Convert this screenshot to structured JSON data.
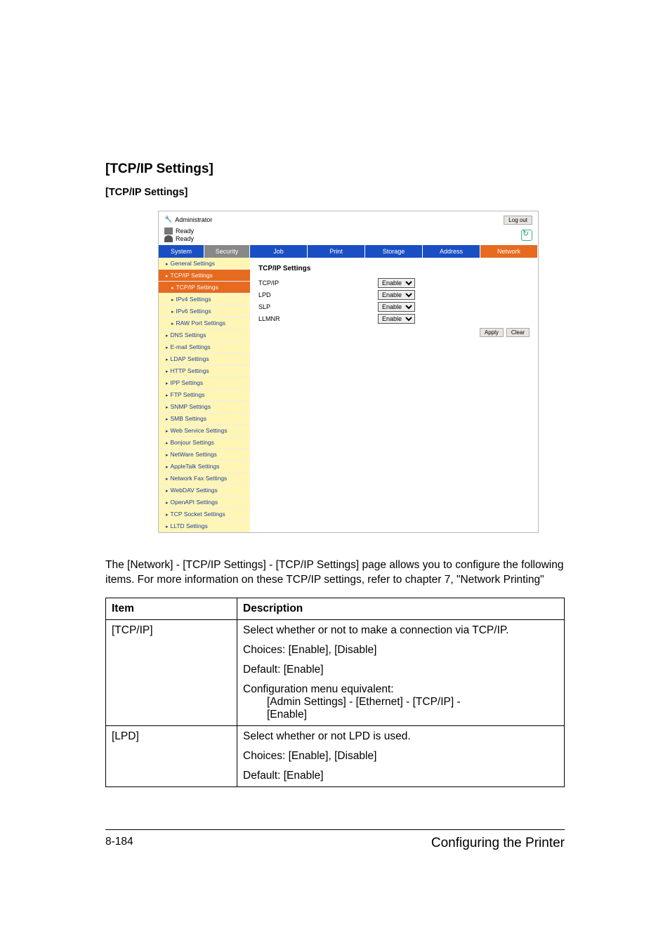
{
  "headings": {
    "section": "[TCP/IP Settings]",
    "sub": "[TCP/IP Settings]"
  },
  "app": {
    "admin_label": "Administrator",
    "logout": "Log out",
    "status1": "Ready",
    "status2": "Ready",
    "side_tabs": [
      "System",
      "Security"
    ],
    "main_tabs": [
      "Job",
      "Print",
      "Storage",
      "Address",
      "Network"
    ],
    "nav": [
      {
        "label": "General Settings",
        "cls": "yellow"
      },
      {
        "label": "TCP/IP Settings",
        "cls": "orange"
      },
      {
        "label": "TCP/IP Settings",
        "cls": "orange child"
      },
      {
        "label": "IPv4 Settings",
        "cls": "yellow child"
      },
      {
        "label": "IPv6 Settings",
        "cls": "yellow child"
      },
      {
        "label": "RAW Port Settings",
        "cls": "yellow child"
      },
      {
        "label": "DNS Settings",
        "cls": "yellow"
      },
      {
        "label": "E-mail Settings",
        "cls": "yellow"
      },
      {
        "label": "LDAP Settings",
        "cls": "yellow"
      },
      {
        "label": "HTTP Settings",
        "cls": "yellow"
      },
      {
        "label": "IPP Settings",
        "cls": "yellow"
      },
      {
        "label": "FTP Settings",
        "cls": "yellow"
      },
      {
        "label": "SNMP Settings",
        "cls": "yellow"
      },
      {
        "label": "SMB Settings",
        "cls": "yellow"
      },
      {
        "label": "Web Service Settings",
        "cls": "yellow"
      },
      {
        "label": "Bonjour Settings",
        "cls": "yellow"
      },
      {
        "label": "NetWare Settings",
        "cls": "yellow"
      },
      {
        "label": "AppleTalk Settings",
        "cls": "yellow"
      },
      {
        "label": "Network Fax Settings",
        "cls": "yellow"
      },
      {
        "label": "WebDAV Settings",
        "cls": "yellow"
      },
      {
        "label": "OpenAPI Settings",
        "cls": "yellow"
      },
      {
        "label": "TCP Socket Settings",
        "cls": "yellow"
      },
      {
        "label": "LLTD Settings",
        "cls": "yellow"
      }
    ],
    "content_title": "TCP/IP Settings",
    "fields": [
      {
        "label": "TCP/IP",
        "value": "Enable"
      },
      {
        "label": "LPD",
        "value": "Enable"
      },
      {
        "label": "SLP",
        "value": "Enable"
      },
      {
        "label": "LLMNR",
        "value": "Enable"
      }
    ],
    "apply": "Apply",
    "clear": "Clear"
  },
  "paragraph": "The [Network] - [TCP/IP Settings] - [TCP/IP Settings] page allows you to configure the following items. For more information on these TCP/IP settings, refer to chapter 7, \"Network Printing\"",
  "table": {
    "headers": [
      "Item",
      "Description"
    ],
    "rows": [
      {
        "item": "[TCP/IP]",
        "desc": {
          "p1": "Select whether or not to make a connection via TCP/IP.",
          "p2": "Choices: [Enable], [Disable]",
          "p3": "Default: [Enable]",
          "p4": "Configuration menu equivalent:",
          "p4a": "[Admin Settings] - [Ethernet] - [TCP/IP] -",
          "p4b": "[Enable]"
        }
      },
      {
        "item": "[LPD]",
        "desc": {
          "p1": "Select whether or not LPD is used.",
          "p2": "Choices: [Enable], [Disable]",
          "p3": "Default: [Enable]"
        }
      }
    ]
  },
  "footer": {
    "left": "8-184",
    "right": "Configuring the Printer"
  }
}
